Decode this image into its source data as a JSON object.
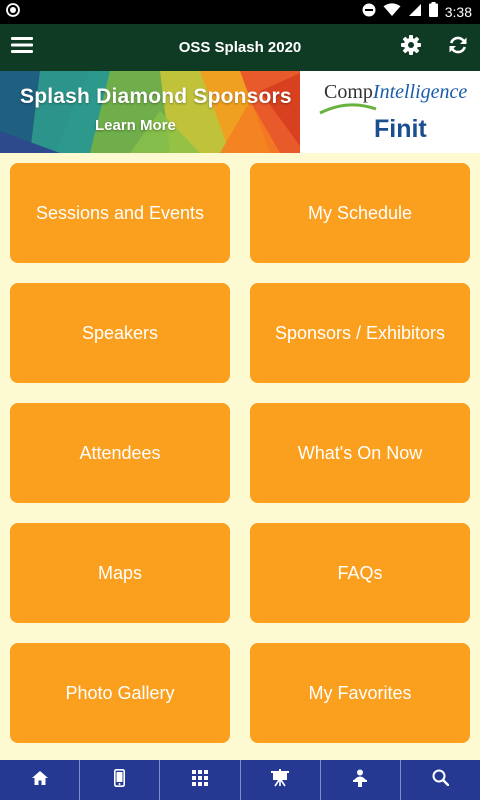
{
  "status_bar": {
    "time": "3:38",
    "icons": [
      "record-icon",
      "do-not-disturb-icon",
      "wifi-icon",
      "cell-signal-icon",
      "battery-icon"
    ]
  },
  "app_bar": {
    "title": "OSS Splash 2020",
    "icons": [
      "menu-icon",
      "gear-icon",
      "refresh-icon"
    ]
  },
  "banner": {
    "title": "Splash Diamond Sponsors",
    "subtitle": "Learn More",
    "sponsor1_part1": "Comp",
    "sponsor1_part2": "Intelligence",
    "sponsor2": "Finit"
  },
  "tiles": [
    {
      "label": "Sessions and Events"
    },
    {
      "label": "My Schedule"
    },
    {
      "label": "Speakers"
    },
    {
      "label": "Sponsors / Exhibitors"
    },
    {
      "label": "Attendees"
    },
    {
      "label": "What's On Now"
    },
    {
      "label": "Maps"
    },
    {
      "label": "FAQs"
    },
    {
      "label": "Photo Gallery"
    },
    {
      "label": "My Favorites"
    }
  ],
  "bottom_nav": {
    "icons": [
      "home-icon",
      "mobile-phone-icon",
      "grid-apps-icon",
      "presentation-board-icon",
      "speaker-podium-icon",
      "search-icon"
    ]
  },
  "colors": {
    "app_bar": "#0f3a24",
    "background": "#fdf9d1",
    "tile": "#fb9f1e",
    "bottom_nav": "#253993"
  }
}
